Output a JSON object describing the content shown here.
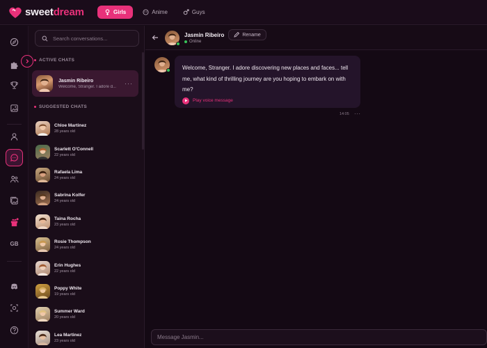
{
  "brand": {
    "name_prefix": "sweet",
    "name_suffix": "dream",
    "accent": "#e8317a"
  },
  "topnav": {
    "items": [
      {
        "label": "Girls",
        "icon": "female-icon",
        "active": true
      },
      {
        "label": "Anime",
        "icon": "anime-icon",
        "active": false
      },
      {
        "label": "Guys",
        "icon": "male-icon",
        "active": false
      }
    ]
  },
  "rail": {
    "items": [
      "explore-icon",
      "puzzle-icon",
      "trophy-icon",
      "gallery-icon",
      "user-icon",
      "chat-icon",
      "users-icon",
      "images-icon",
      "gift-icon"
    ],
    "language": "GB",
    "bottom": [
      "discord-icon",
      "camera-icon",
      "help-icon"
    ]
  },
  "sidebar": {
    "search_placeholder": "Search conversations...",
    "active_label": "ACTIVE CHATS",
    "suggested_label": "SUGGESTED CHATS",
    "active_chat": {
      "name": "Jasmin Ribeiro",
      "preview": "Welcome, Stranger. I adore d..."
    },
    "suggested": [
      {
        "name": "Chloe Martinez",
        "age": "28 years old"
      },
      {
        "name": "Scarlett O'Connell",
        "age": "22 years old"
      },
      {
        "name": "Rafaela Lima",
        "age": "24 years old"
      },
      {
        "name": "Sabrina Kolfer",
        "age": "24 years old"
      },
      {
        "name": "Taina Rocha",
        "age": "23 years old"
      },
      {
        "name": "Rosie Thompson",
        "age": "24 years old"
      },
      {
        "name": "Erin Hughes",
        "age": "22 years old"
      },
      {
        "name": "Poppy White",
        "age": "19 years old"
      },
      {
        "name": "Summer Ward",
        "age": "20 years old"
      },
      {
        "name": "Lea Martinez",
        "age": "23 years old"
      }
    ]
  },
  "chat": {
    "name": "Jasmin Ribeiro",
    "status": "Online",
    "rename_label": "Rename",
    "message": {
      "text": "Welcome, Stranger. I adore discovering new places and faces... tell me, what kind of thrilling journey are you hoping to embark on with me?",
      "voice_label": "Play voice message",
      "time": "14:05"
    },
    "input_placeholder": "Message Jasmin..."
  }
}
